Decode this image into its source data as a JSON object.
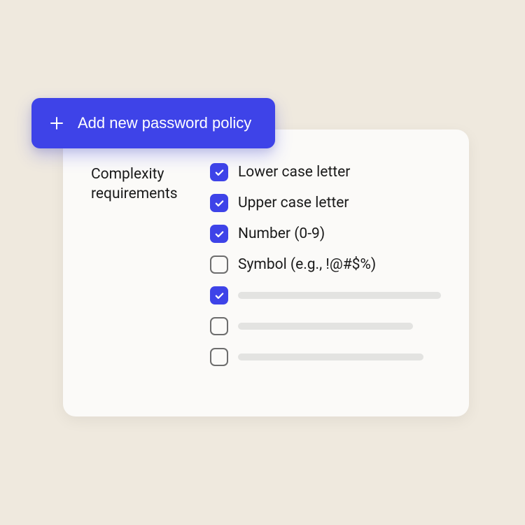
{
  "button": {
    "add_label": "Add new password policy"
  },
  "section": {
    "title": "Complexity requirements"
  },
  "options": [
    {
      "label": "Lower case letter",
      "checked": true
    },
    {
      "label": "Upper case letter",
      "checked": true
    },
    {
      "label": "Number (0-9)",
      "checked": true
    },
    {
      "label": "Symbol (e.g., !@#$%)",
      "checked": false
    }
  ],
  "placeholders": [
    {
      "checked": true
    },
    {
      "checked": false
    },
    {
      "checked": false
    }
  ],
  "colors": {
    "accent": "#3e43e8",
    "background": "#efe9de",
    "card": "#fbfaf8"
  }
}
